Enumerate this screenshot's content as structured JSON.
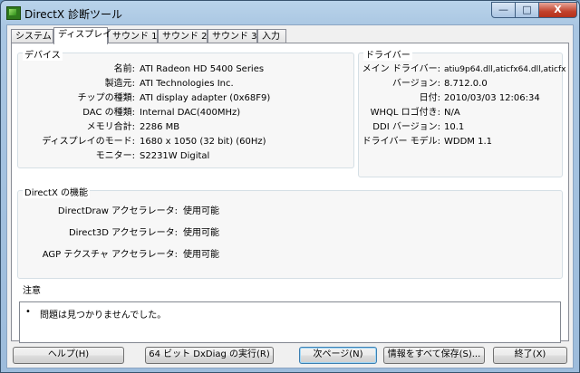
{
  "window": {
    "title": "DirectX 診断ツール",
    "min_label": "—",
    "max_label": "□",
    "close_label": "X"
  },
  "tabs": [
    {
      "label": "システム"
    },
    {
      "label": "ディスプレイ"
    },
    {
      "label": "サウンド 1"
    },
    {
      "label": "サウンド 2"
    },
    {
      "label": "サウンド 3"
    },
    {
      "label": "入力"
    }
  ],
  "device": {
    "title": "デバイス",
    "rows": [
      {
        "label": "名前:",
        "value": "ATI Radeon HD 5400 Series"
      },
      {
        "label": "製造元:",
        "value": "ATI Technologies Inc."
      },
      {
        "label": "チップの種類:",
        "value": "ATI display adapter (0x68F9)"
      },
      {
        "label": "DAC の種類:",
        "value": "Internal DAC(400MHz)"
      },
      {
        "label": "メモリ合計:",
        "value": "2286 MB"
      },
      {
        "label": "ディスプレイのモード:",
        "value": "1680 x 1050 (32 bit) (60Hz)"
      },
      {
        "label": "モニター:",
        "value": "S2231W Digital"
      }
    ]
  },
  "driver": {
    "title": "ドライバー",
    "rows": [
      {
        "label": "メイン ドライバー:",
        "value": "atiu9p64.dll,aticfx64.dll,aticfx"
      },
      {
        "label": "バージョン:",
        "value": "8.712.0.0"
      },
      {
        "label": "日付:",
        "value": "2010/03/03 12:06:34"
      },
      {
        "label": "WHQL ロゴ付き:",
        "value": "N/A"
      },
      {
        "label": "DDI バージョン:",
        "value": "10.1"
      },
      {
        "label": "ドライバー モデル:",
        "value": "WDDM 1.1"
      }
    ]
  },
  "directx": {
    "title": "DirectX の機能",
    "rows": [
      {
        "label": "DirectDraw アクセラレータ:",
        "value": "使用可能"
      },
      {
        "label": "Direct3D アクセラレータ:",
        "value": "使用可能"
      },
      {
        "label": "AGP テクスチャ アクセラレータ:",
        "value": "使用可能"
      }
    ]
  },
  "notes": {
    "title": "注意",
    "bullet": "•",
    "items": [
      "問題は見つかりませんでした。"
    ]
  },
  "buttons": {
    "help": "ヘルプ(H)",
    "run64": "64 ビット DxDiag の実行(R)",
    "next": "次ページ(N)",
    "save": "情報をすべて保存(S)...",
    "exit": "終了(X)"
  }
}
